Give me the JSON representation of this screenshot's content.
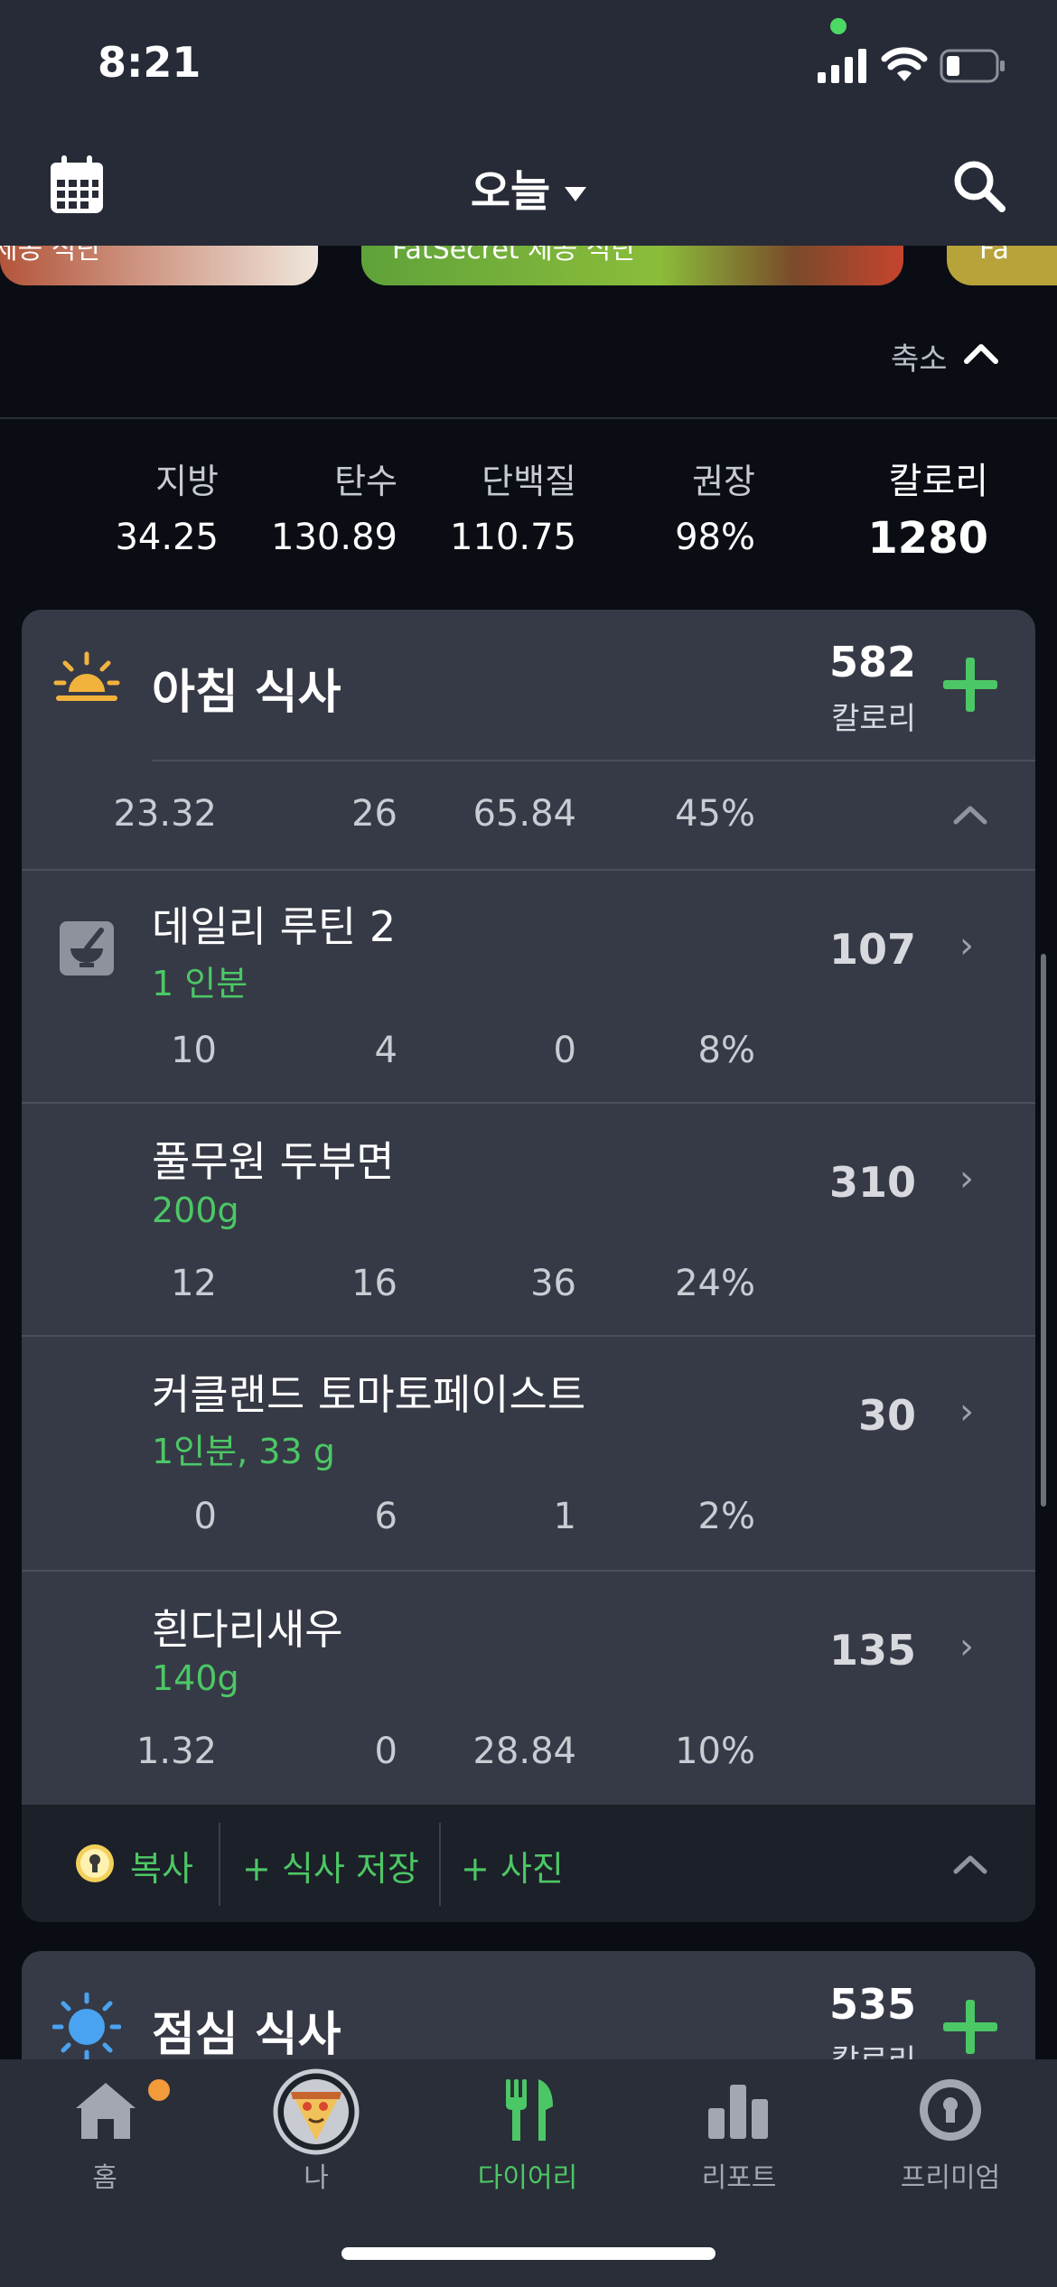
{
  "status_bar": {
    "time": "8:21"
  },
  "header": {
    "title": "오늘"
  },
  "banner": {
    "left_text": "제공 식단",
    "center_text": "FatSecret 제공 식단",
    "right_text": "Fa"
  },
  "collapse": {
    "label": "축소"
  },
  "totals": {
    "headers": {
      "fat": "지방",
      "carbs": "탄수",
      "protein": "단백질",
      "rdi": "권장",
      "calories": "칼로리"
    },
    "values": {
      "fat": "34.25",
      "carbs": "130.89",
      "protein": "110.75",
      "rdi": "98%",
      "calories": "1280"
    }
  },
  "breakfast": {
    "title": "아침 식사",
    "calories": "582",
    "calories_label": "칼로리",
    "summary": {
      "fat": "23.32",
      "carbs": "26",
      "protein": "65.84",
      "rdi": "45%"
    },
    "items": [
      {
        "name": "데일리 루틴 2",
        "portion": "1 인분",
        "calories": "107",
        "fat": "10",
        "carbs": "4",
        "protein": "0",
        "rdi": "8%"
      },
      {
        "name": "풀무원 두부면",
        "portion": "200g",
        "calories": "310",
        "fat": "12",
        "carbs": "16",
        "protein": "36",
        "rdi": "24%"
      },
      {
        "name": "커클랜드 토마토페이스트",
        "portion": "1인분, 33 g",
        "calories": "30",
        "fat": "0",
        "carbs": "6",
        "protein": "1",
        "rdi": "2%"
      },
      {
        "name": "흰다리새우",
        "portion": "140g",
        "calories": "135",
        "fat": "1.32",
        "carbs": "0",
        "protein": "28.84",
        "rdi": "10%"
      }
    ],
    "actions": {
      "copy": "복사",
      "save_meal": "+ 식사 저장",
      "photo": "+ 사진"
    }
  },
  "lunch": {
    "title": "점심 식사",
    "calories": "535",
    "calories_label": "칼로리"
  },
  "nav": {
    "home": "홈",
    "me": "나",
    "diary": "다이어리",
    "report": "리포트",
    "premium": "프리미엄"
  },
  "colors": {
    "accent_green": "#4cc765",
    "card_bg": "#363a46",
    "badge_orange": "#f39a3b"
  }
}
